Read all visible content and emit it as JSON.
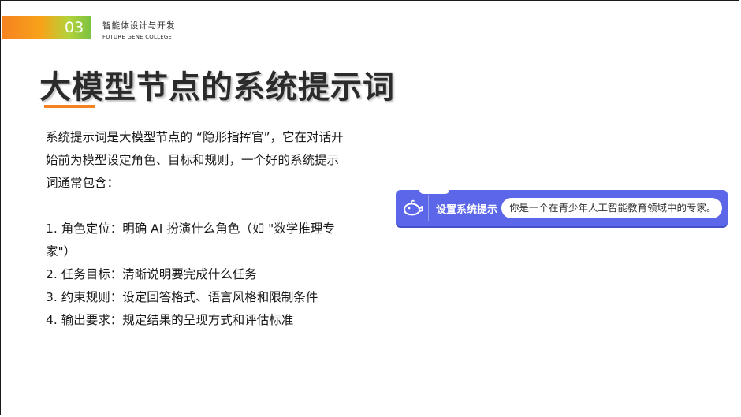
{
  "header": {
    "section_number": "03",
    "course_title_cn": "智能体设计与开发",
    "course_title_en": "FUTURE GENE COLLEGE"
  },
  "slide": {
    "title": "大模型节点的系统提示词",
    "intro": "系统提示词是大模型节点的 “隐形指挥官”，它在对话开始前为模型设定角色、目标和规则，一个好的系统提示词通常包含：",
    "list": [
      "1. 角色定位：明确 AI 扮演什么角色（如 \"数学推理专家\"）",
      "2. 任务目标：清晰说明要完成什么任务",
      "3. 约束规则：设定回答格式、语言风格和限制条件",
      "4. 输出要求：规定结果的呈现方式和评估标准"
    ]
  },
  "block": {
    "label": "设置系统提示",
    "value": "你是一个在青少年人工智能教育领域中的专家。",
    "icon": "whale-icon",
    "color": "#5b66e8"
  },
  "colors": {
    "accent": "#f58220",
    "badge_green": "#7cc242"
  }
}
